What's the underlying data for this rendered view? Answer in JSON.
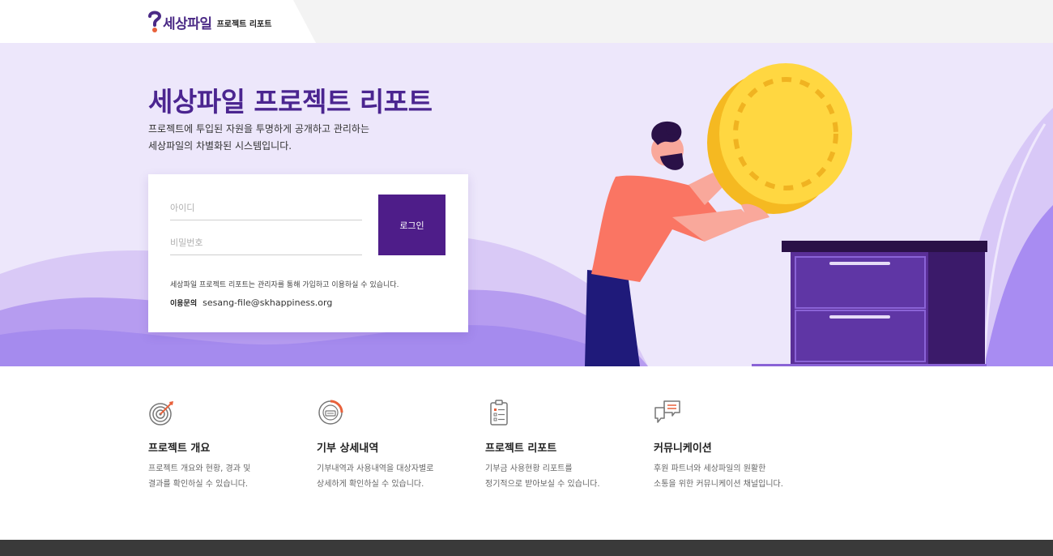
{
  "header": {
    "logo_text": "세상파일",
    "logo_sub": "프로젝트 리포트"
  },
  "hero": {
    "title": "세상파일 프로젝트 리포트",
    "desc_line1": "프로젝트에 투입된 자원을 투명하게 공개하고 관리하는",
    "desc_line2": "세상파일의 차별화된 시스템입니다."
  },
  "login": {
    "id_placeholder": "아이디",
    "pw_placeholder": "비밀번호",
    "button_label": "로그인",
    "notice": "세상파일 프로젝트 리포트는 관리자를 통해 가입하고 이용하실 수 있습니다.",
    "contact_label": "이용문의",
    "contact_email": "sesang-file@skhappiness.org"
  },
  "features": [
    {
      "icon": "target-icon",
      "title": "프로젝트 개요",
      "desc1": "프로젝트 개요와 현황, 경과 및",
      "desc2": "결과를 확인하실 수 있습니다."
    },
    {
      "icon": "donation-chart-icon",
      "title": "기부 상세내역",
      "desc1": "기부내역과 사용내역을 대상자별로",
      "desc2": "상세하게 확인하실 수 있습니다."
    },
    {
      "icon": "clipboard-icon",
      "title": "프로젝트 리포트",
      "desc1": "기부금 사용현황 리포트를",
      "desc2": "정기적으로 받아보실 수 있습니다."
    },
    {
      "icon": "chat-bubbles-icon",
      "title": "커뮤니케이션",
      "desc1": "후원 파트너와 세상파일의 원활한",
      "desc2": "소통을 위한 커뮤니케이션 채널입니다."
    }
  ],
  "colors": {
    "brand_purple": "#4e1d89",
    "hero_bg": "#ede7fb",
    "title_purple": "#4b2590",
    "accent_orange": "#e8613b",
    "footer": "#3a3a3a"
  }
}
